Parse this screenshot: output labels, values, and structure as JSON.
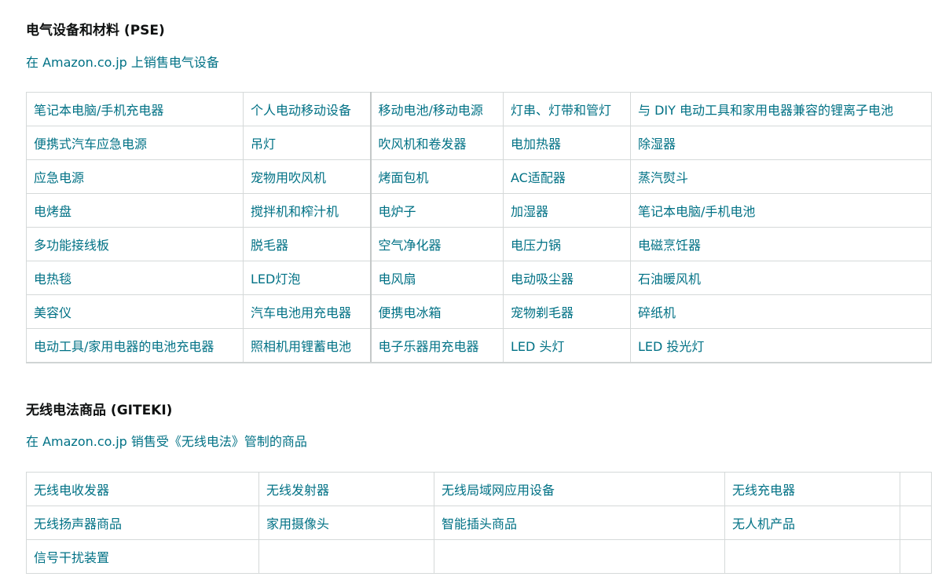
{
  "pse": {
    "title": "电气设备和材料 (PSE)",
    "link": "在 Amazon.co.jp 上销售电气设备",
    "rows": [
      [
        "笔记本电脑/手机充电器",
        "个人电动移动设备",
        "移动电池/移动电源",
        "灯串、灯带和管灯",
        "与 DIY 电动工具和家用电器兼容的锂离子电池"
      ],
      [
        "便携式汽车应急电源",
        "吊灯",
        "吹风机和卷发器",
        "电加热器",
        "除湿器"
      ],
      [
        "应急电源",
        "宠物用吹风机",
        "烤面包机",
        "AC适配器",
        "蒸汽熨斗"
      ],
      [
        "电烤盘",
        "搅拌机和榨汁机",
        "电炉子",
        "加湿器",
        "笔记本电脑/手机电池"
      ],
      [
        "多功能接线板",
        "脱毛器",
        "空气净化器",
        "电压力锅",
        "电磁烹饪器"
      ],
      [
        "电热毯",
        "LED灯泡",
        "电风扇",
        "电动吸尘器",
        "石油暖风机"
      ],
      [
        "美容仪",
        "汽车电池用充电器",
        "便携电冰箱",
        "宠物剃毛器",
        "碎纸机"
      ],
      [
        "电动工具/家用电器的电池充电器",
        "照相机用锂蓄电池",
        "电子乐器用充电器",
        "LED 头灯",
        "LED 投光灯"
      ]
    ]
  },
  "giteki": {
    "title": "无线电法商品 (GITEKI)",
    "link": "在 Amazon.co.jp 销售受《无线电法》管制的商品",
    "rows": [
      [
        "无线电收发器",
        "无线发射器",
        "无线局域网应用设备",
        "无线充电器",
        ""
      ],
      [
        "无线扬声器商品",
        "家用摄像头",
        "智能插头商品",
        "无人机产品",
        ""
      ],
      [
        "信号干扰装置",
        "",
        "",
        "",
        ""
      ]
    ]
  }
}
